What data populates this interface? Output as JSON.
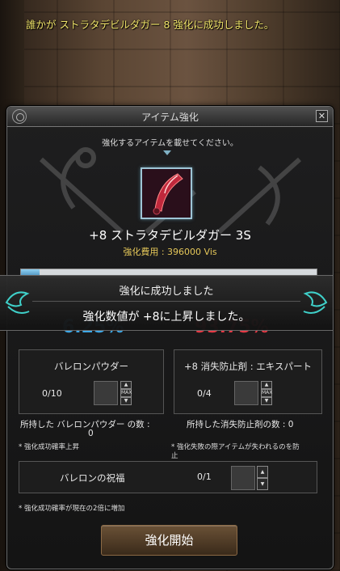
{
  "system_message": "誰かが ストラタデビルダガー 8 強化に成功しました。",
  "window": {
    "title": "アイテム強化",
    "close_label": "✕",
    "subtitle": "強化するアイテムを載せてください。"
  },
  "item": {
    "name": "+8 ストラタデビルダガー 3S",
    "cost": "強化費用 : 396000 Vis"
  },
  "rates": {
    "success": "6.25%",
    "fail": "93.75%",
    "success_fraction": 0.0625
  },
  "popup": {
    "line1": "強化に成功しました",
    "line2": "強化数値が +8に上昇しました。"
  },
  "powder_panel": {
    "title": "バレロンパウダー",
    "count": "0/10",
    "up": "▲",
    "max": "MAX",
    "down": "▼",
    "owned_label": "所持した バレロンパウダー の数 :",
    "owned_value": "0",
    "note": "* 強化成功確率上昇"
  },
  "protect_panel": {
    "title": "+8 消失防止剤 : エキスパート",
    "count": "0/4",
    "up": "▲",
    "max": "MAX",
    "down": "▼",
    "owned": "所持した消失防止剤の数 : 0",
    "note_line1": "* 強化失敗の際アイテムが失われるのを防",
    "note_line2": "止"
  },
  "blessing_panel": {
    "title": "バレロンの祝福",
    "count": "0/1",
    "up": "▲",
    "down": "▼",
    "note": "* 強化成功確率が現在の2倍に増加"
  },
  "start_button": "強化開始",
  "colors": {
    "system_text": "#f1e46a",
    "cost_text": "#e6c85a",
    "success": "#3fa9e8",
    "fail": "#e63a46",
    "teal_ornament": "#3fd0c9"
  }
}
